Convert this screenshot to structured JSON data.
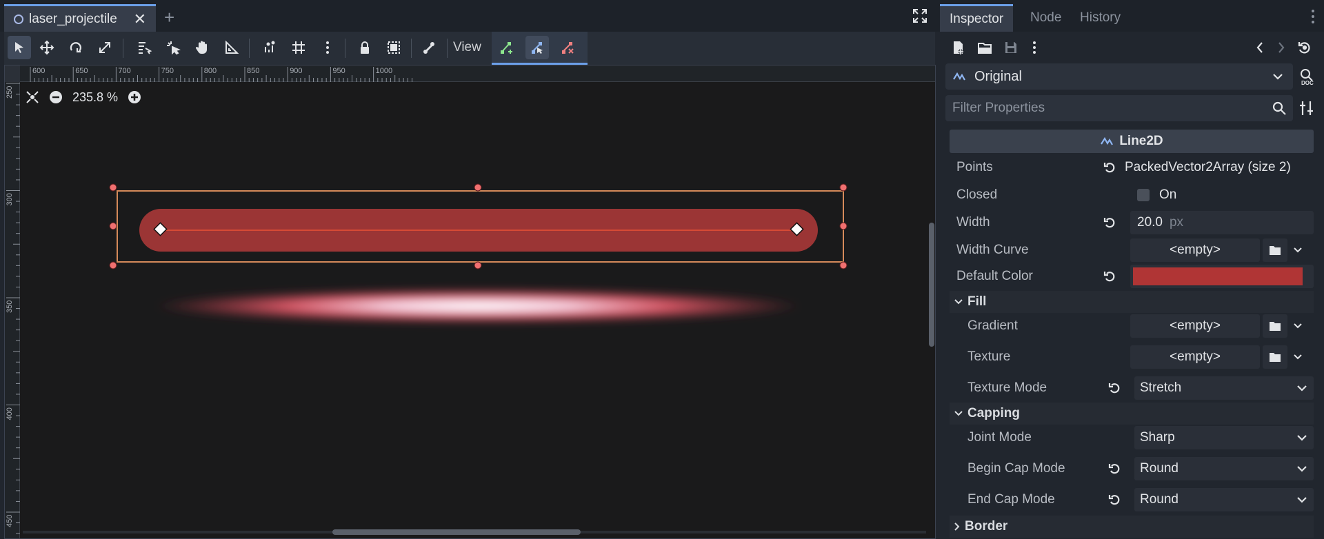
{
  "editor": {
    "scene_tab": "laser_projectile",
    "toolbar": {
      "view_label": "View"
    },
    "zoom": "235.8 %",
    "hruler_labels": [
      "600",
      "650",
      "700",
      "750",
      "800",
      "850",
      "900",
      "950",
      "1000"
    ],
    "vruler_labels": [
      "250",
      "300",
      "350",
      "400",
      "450"
    ],
    "line_color": "#9b3535"
  },
  "inspector": {
    "tabs": [
      "Inspector",
      "Node",
      "History"
    ],
    "resource": "Original",
    "filter_placeholder": "Filter Properties",
    "class_name": "Line2D",
    "properties": {
      "points": {
        "label": "Points",
        "value": "PackedVector2Array (size 2)"
      },
      "closed": {
        "label": "Closed",
        "value": "On"
      },
      "width": {
        "label": "Width",
        "value": "20.0",
        "unit": "px"
      },
      "width_curve": {
        "label": "Width Curve",
        "value": "<empty>"
      },
      "default_color": {
        "label": "Default Color",
        "color": "#b03535"
      }
    },
    "sections": {
      "fill": "Fill",
      "capping": "Capping",
      "border": "Border"
    },
    "fill": {
      "gradient": {
        "label": "Gradient",
        "value": "<empty>"
      },
      "texture": {
        "label": "Texture",
        "value": "<empty>"
      },
      "texture_mode": {
        "label": "Texture Mode",
        "value": "Stretch"
      }
    },
    "capping": {
      "joint_mode": {
        "label": "Joint Mode",
        "value": "Sharp"
      },
      "begin_cap_mode": {
        "label": "Begin Cap Mode",
        "value": "Round"
      },
      "end_cap_mode": {
        "label": "End Cap Mode",
        "value": "Round"
      }
    }
  }
}
